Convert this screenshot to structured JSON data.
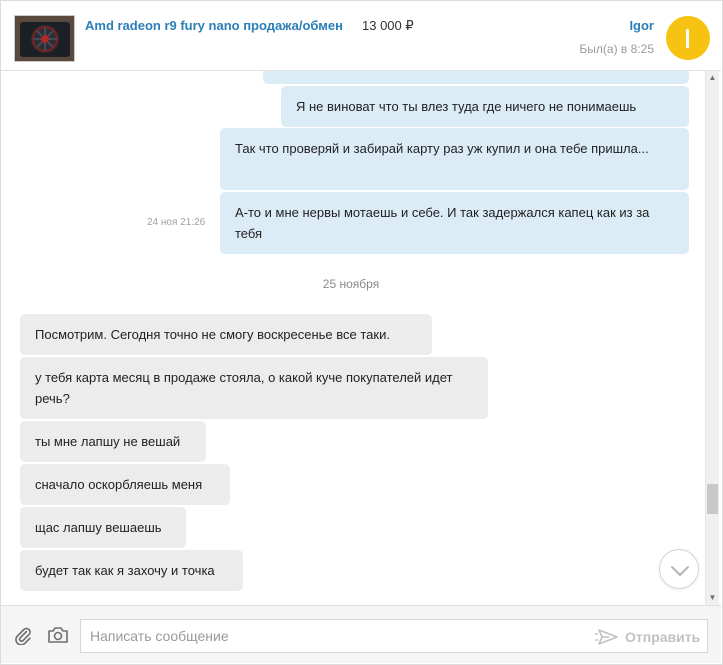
{
  "header": {
    "listing_title": "Amd radeon r9 fury nano продажа/обмен",
    "listing_price": "13 000 ₽",
    "user_name": "Igor",
    "last_seen": "Был(а) в 8:25",
    "avatar_color": "#f7c313",
    "link_color": "#2a7fb8"
  },
  "messages": {
    "out_1": "Я не виноват что ты  влез туда  где ничего не понимаешь",
    "out_2": "Так что проверяй и забирай карту раз уж купил и она тебе пришла...",
    "out_3": "А-то и мне нервы мотаешь и себе. И так задержался капец как из за тебя",
    "out_3_time": "24 ноя 21:26",
    "date_separator": "25 ноября",
    "in_1": "Посмотрим. Сегодня точно не смогу воскресенье все таки.",
    "in_2": "у тебя карта месяц в продаже стояла, о какой куче покупателей идет речь?",
    "in_3": "ты мне лапшу не вешай",
    "in_4": "сначало оскорбляешь меня",
    "in_5": "щас лапшу вешаешь",
    "in_6": "будет так как я захочу и точка"
  },
  "composer": {
    "placeholder": "Написать сообщение",
    "value": "",
    "send_label": "Отправить",
    "attach_icon": "paperclip-icon",
    "camera_icon": "camera-icon"
  },
  "colors": {
    "outgoing_bubble": "#dcecf7",
    "incoming_bubble": "#ececec"
  }
}
